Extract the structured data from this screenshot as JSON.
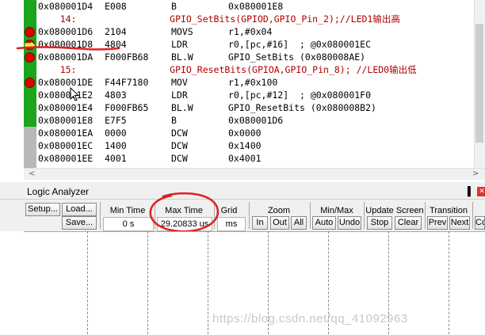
{
  "disassembly": {
    "rows": [
      {
        "addr": "0x080001D4",
        "code": "E008",
        "mnem": "B",
        "ops": "0x080001E8"
      },
      {
        "source": "    14:                 GPIO_SetBits(GPIOD,GPIO_Pin_2);//LED1输出高"
      },
      {
        "addr": "0x080001D6",
        "code": "2104",
        "mnem": "MOVS",
        "ops": "r1,#0x04"
      },
      {
        "addr": "0x080001D8",
        "code": "4804",
        "mnem": "LDR",
        "ops": "r0,[pc,#16]  ; @0x080001EC"
      },
      {
        "addr": "0x080001DA",
        "code": "F000FB68",
        "mnem": "BL.W",
        "ops": "GPIO_SetBits (0x080008AE)"
      },
      {
        "source": "    15:                 GPIO_ResetBits(GPIOA,GPIO_Pin_8); //LED0输出低"
      },
      {
        "addr": "0x080001DE",
        "code": "F44F7180",
        "mnem": "MOV",
        "ops": "r1,#0x100"
      },
      {
        "addr": "0x080001E2",
        "code": "4803",
        "mnem": "LDR",
        "ops": "r0,[pc,#12]  ; @0x080001F0"
      },
      {
        "addr": "0x080001E4",
        "code": "F000FB65",
        "mnem": "BL.W",
        "ops": "GPIO_ResetBits (0x080008B2)"
      },
      {
        "addr": "0x080001E8",
        "code": "E7F5",
        "mnem": "B",
        "ops": "0x080001D6"
      },
      {
        "addr": "0x080001EA",
        "code": "0000",
        "mnem": "DCW",
        "ops": "0x0000"
      },
      {
        "addr": "0x080001EC",
        "code": "1400",
        "mnem": "DCW",
        "ops": "0x1400"
      },
      {
        "addr": "0x080001EE",
        "code": "4001",
        "mnem": "DCW",
        "ops": "0x4001"
      }
    ]
  },
  "panel": {
    "title": "Logic Analyzer",
    "pin_glyph": "▐",
    "close_glyph": "✕"
  },
  "toolbar": {
    "setup": "Setup...",
    "load": "Load...",
    "save": "Save...",
    "min_time_label": "Min Time",
    "min_time_value": "0 s",
    "max_time_label": "Max Time",
    "max_time_value": "29.20833 us",
    "grid_label": "Grid",
    "grid_value": "ms",
    "zoom_label": "Zoom",
    "zoom_in": "In",
    "zoom_out": "Out",
    "zoom_all": "All",
    "minmax_label": "Min/Max",
    "auto": "Auto",
    "undo": "Undo",
    "update_label": "Update Screen",
    "stop": "Stop",
    "clear": "Clear",
    "transition_label": "Transition",
    "prev": "Prev",
    "next": "Next",
    "co": "Co"
  },
  "scroll": {
    "left": "<",
    "right": ">"
  },
  "watermark": "https://blog.csdn.net/qq_41092963",
  "colors": {
    "breakpoint": "#e00000",
    "gutter": "#1aa51a",
    "annotation": "#e02020",
    "source_text": "#b00000"
  }
}
